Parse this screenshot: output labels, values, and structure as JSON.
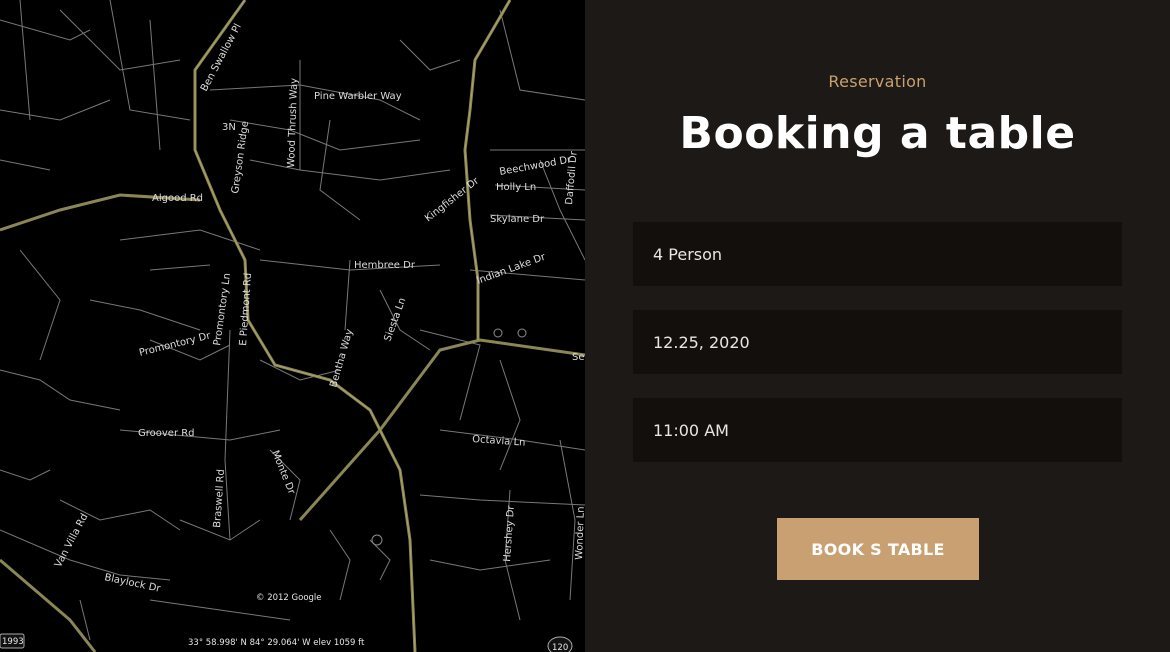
{
  "map": {
    "streets": [
      "Ben Swallow Pl",
      "Pine Warbler Way",
      "Wood Thrush Way",
      "3N",
      "Greyson Ridge",
      "Algood Rd",
      "Hembree Dr",
      "Kingfisher Dr",
      "Beechwood Dr",
      "Holly Ln",
      "Daffodil Dr",
      "Skylane Dr",
      "Indian Lake Dr",
      "Promontory Ln",
      "E Piedmont Rd",
      "Promontory Dr",
      "Bentha Way",
      "Siesta Ln",
      "Groover Rd",
      "Braswell Rd",
      "Monte Dr",
      "Octavia Ln",
      "Hershey Dr",
      "Wonder Ln",
      "Van Villa Rd",
      "Blaylock Dr",
      "Se"
    ],
    "copyright": "© 2012 Google",
    "coordinates": "33° 58.998' N  84° 29.064' W  elev  1059 ft",
    "route_left": "1993",
    "route_right": "120"
  },
  "reservation": {
    "eyebrow": "Reservation",
    "title": "Booking a table",
    "persons": "4 Person",
    "date": "12.25, 2020",
    "time": "11:00 AM",
    "button_label": "BOOK S TABLE"
  },
  "colors": {
    "accent": "#c9a071",
    "panel_bg": "#1c1916",
    "field_bg": "#120f0d",
    "road": "#8b8655"
  }
}
